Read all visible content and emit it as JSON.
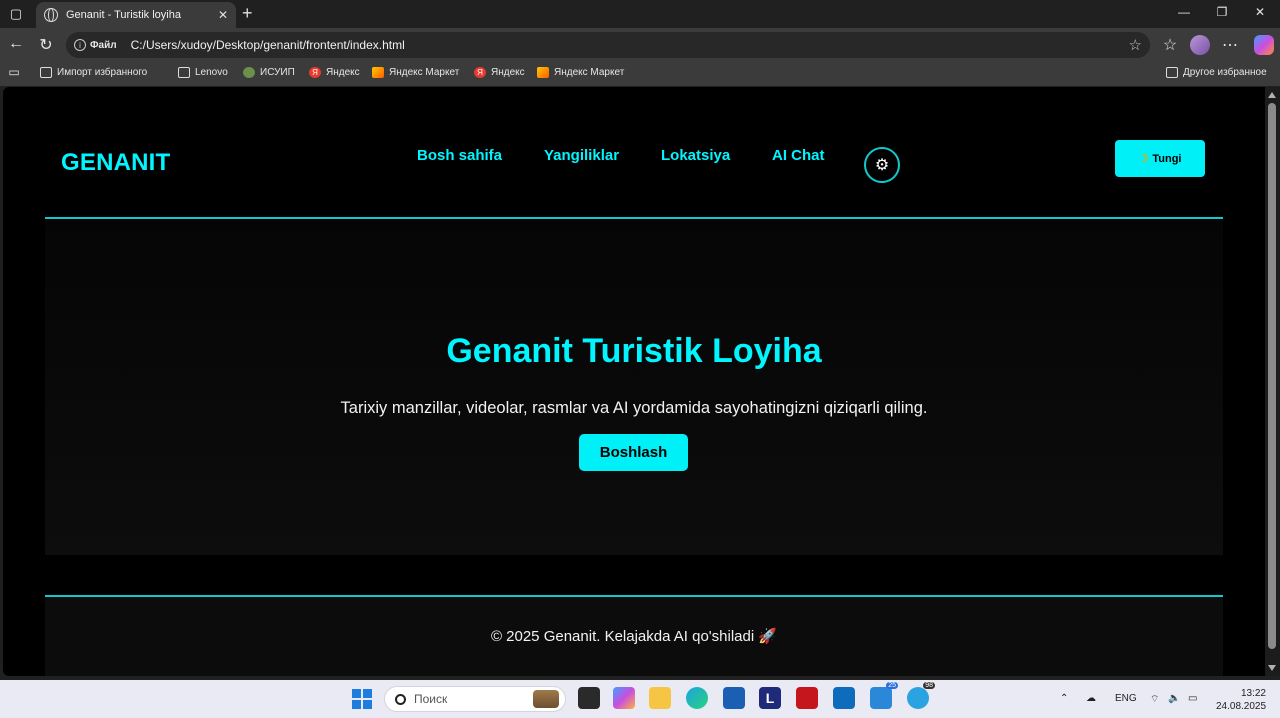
{
  "browser": {
    "tab_title": "Genanit - Turistik loyiha",
    "address_scheme": "Файл",
    "address_url": "C:/Users/xudoy/Desktop/genanit/frontent/index.html"
  },
  "bookmarks": [
    {
      "label": "Импорт избранного",
      "icon": "import-icon"
    },
    {
      "label": "Lenovo",
      "icon": "folder-icon"
    },
    {
      "label": "ИСУИП",
      "icon": "isuip-icon"
    },
    {
      "label": "Яндекс",
      "icon": "yandex-icon"
    },
    {
      "label": "Яндекс Маркет",
      "icon": "market-icon"
    },
    {
      "label": "Яндекс",
      "icon": "yandex-icon"
    },
    {
      "label": "Яндекс Маркет",
      "icon": "market-icon"
    }
  ],
  "bookmarks_other": "Другое избранное",
  "site": {
    "logo": "GENANIT",
    "nav": [
      "Bosh sahifa",
      "Yangiliklar",
      "Lokatsiya",
      "AI Chat"
    ],
    "theme_button": "Tungi",
    "hero_title": "Genanit Turistik Loyiha",
    "hero_text": "Tarixiy manzillar, videolar, rasmlar va AI yordamida sayohatingizni qiziqarli qiling.",
    "start_button": "Boshlash",
    "footer": "© 2025 Genanit. Kelajakda AI qo'shiladi 🚀"
  },
  "colors": {
    "accent": "#00f5ff",
    "background": "#000000"
  },
  "taskbar": {
    "search_placeholder": "Поиск",
    "language": "ENG",
    "time": "13:22",
    "date": "24.08.2025",
    "badge_1": "25",
    "badge_2": "98"
  }
}
